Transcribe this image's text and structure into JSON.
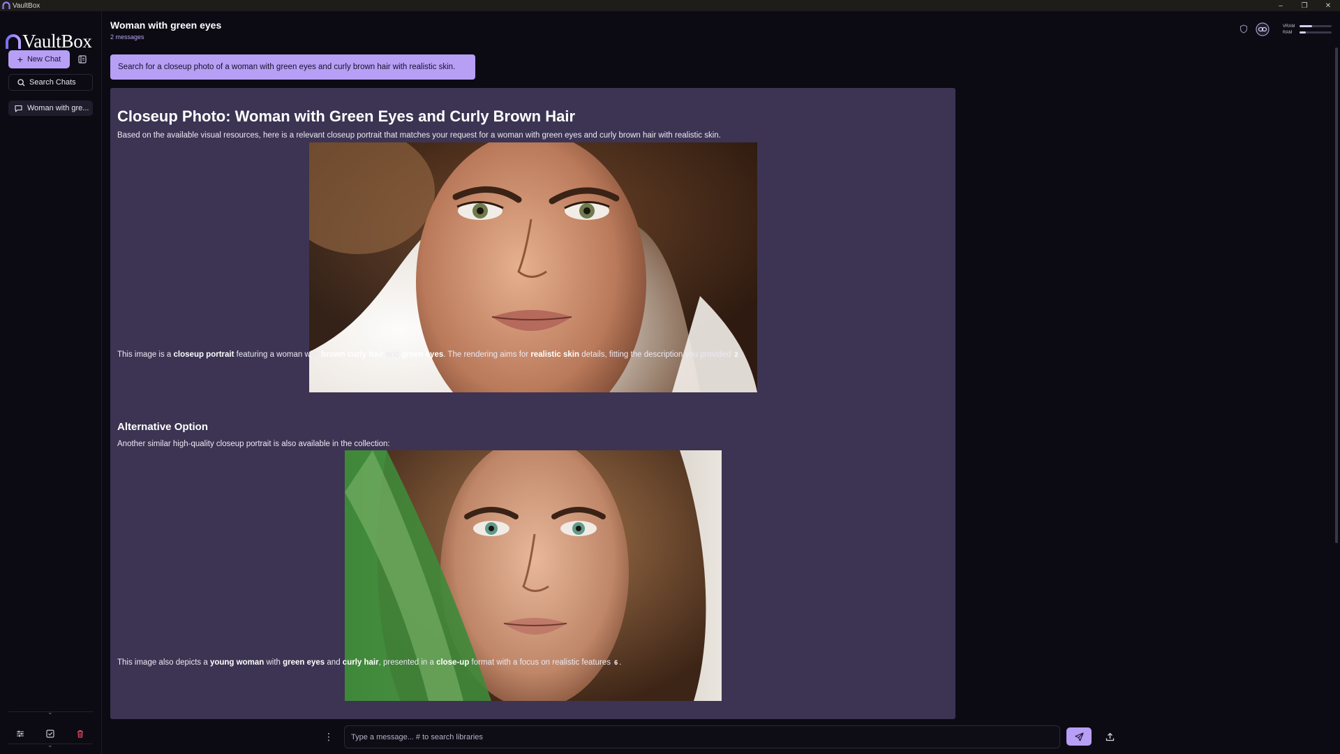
{
  "app": {
    "name": "VaultBox",
    "icon": "vaultbox-arch-logo"
  },
  "window_controls": [
    "minimize-icon",
    "restore-icon",
    "close-icon"
  ],
  "sidebar": {
    "logo_text": "VaultBox",
    "new_chat_label": "New Chat",
    "search_label": "Search Chats",
    "chats": [
      {
        "label": "Woman with gre..."
      }
    ],
    "bottom_tools": [
      "sliders-icon",
      "checkbox-icon",
      "trash-icon"
    ]
  },
  "header": {
    "title": "Woman with green eyes",
    "subtitle": "2 messages",
    "meters": [
      {
        "label": "VRAM",
        "level": 0.4
      },
      {
        "label": "RAM",
        "level": 0.2
      }
    ]
  },
  "user_message": "Search for a closeup photo of a woman with green eyes and curly brown hair with realistic skin.",
  "assistant": {
    "title": "Closeup Photo: Woman with Green Eyes and Curly Brown Hair",
    "intro": "Based on the available visual resources, here is a relevant closeup portrait that matches your request for a woman with green eyes and curly brown hair with realistic skin.",
    "p1": {
      "t1": "This image is a ",
      "b1": "closeup portrait",
      "t2": " featuring a woman with ",
      "b2": "brown curly hair",
      "t3": " and ",
      "b3": "green eyes",
      "t4": ". The rendering aims for ",
      "b4": "realistic skin",
      "t5": " details, fitting the description you provided ",
      "cite": "2",
      "t6": "."
    },
    "section_heading": "Alternative Option",
    "alt_intro": "Another similar high-quality closeup portrait is also available in the collection:",
    "p2": {
      "t1": "This image also depicts a ",
      "b1": "young woman",
      "t2": " with ",
      "b2": "green eyes",
      "t3": " and ",
      "b3": "curly hair",
      "t4": ", presented in a ",
      "b4": "close-up",
      "t5": " format with a focus on realistic features ",
      "cite": "6",
      "t6": "."
    }
  },
  "composer": {
    "placeholder": "Type a message... # to search libraries",
    "send_icon": "paper-plane-icon",
    "upload_icon": "upload-icon"
  },
  "colors": {
    "accent": "#b79ff5",
    "background": "#0c0b14",
    "assistant_panel": "#3c3452"
  }
}
